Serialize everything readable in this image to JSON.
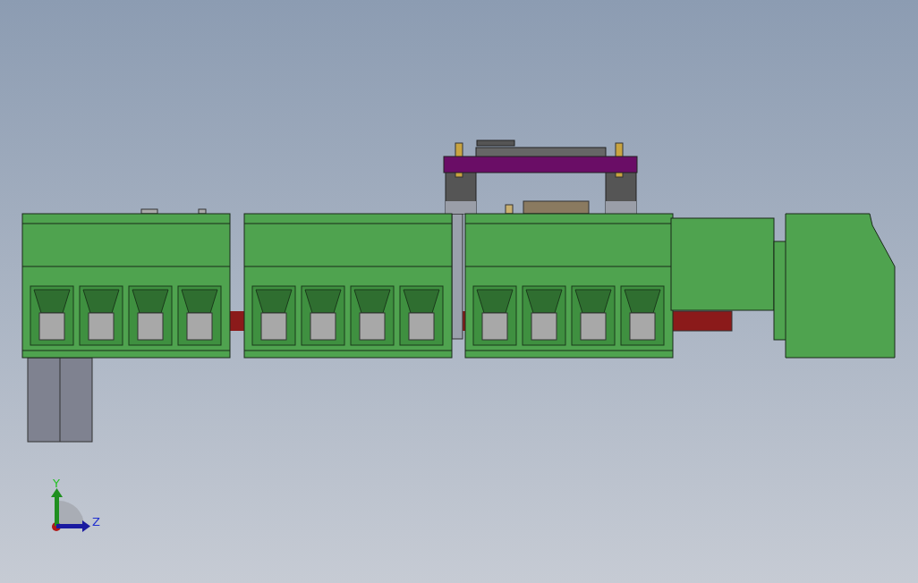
{
  "axis_triad": {
    "axes": [
      {
        "kind": "y",
        "label": "Y"
      },
      {
        "kind": "z",
        "label": "Z"
      }
    ]
  }
}
